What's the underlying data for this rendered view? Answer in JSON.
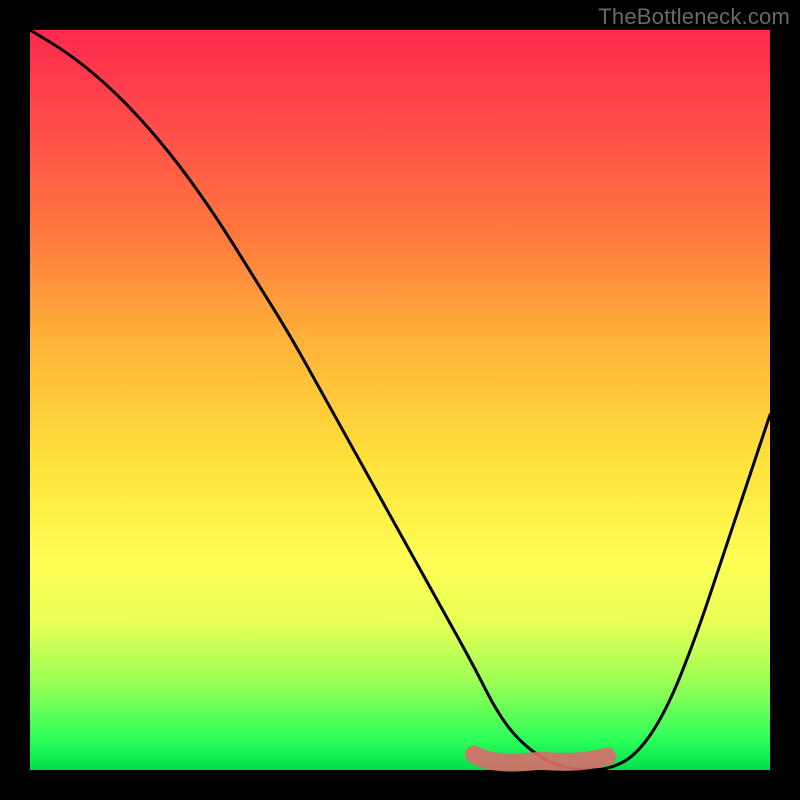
{
  "watermark": "TheBottleneck.com",
  "colors": {
    "curve": "#000000",
    "accent_blob": "#d66f6a",
    "background_black": "#000000"
  },
  "chart_data": {
    "type": "line",
    "title": "",
    "xlabel": "",
    "ylabel": "",
    "xlim": [
      0,
      100
    ],
    "ylim": [
      0,
      100
    ],
    "grid": false,
    "legend": false,
    "series": [
      {
        "name": "bottleneck-curve",
        "x": [
          0,
          5,
          10,
          15,
          20,
          25,
          30,
          35,
          40,
          45,
          50,
          55,
          60,
          63,
          66,
          70,
          74,
          78,
          82,
          86,
          90,
          94,
          98,
          100
        ],
        "y": [
          100,
          97,
          93,
          88,
          82,
          75,
          67,
          59,
          50,
          41,
          32,
          23,
          14,
          8,
          4,
          1,
          0,
          0,
          2,
          8,
          18,
          30,
          42,
          48
        ]
      }
    ],
    "annotations": [
      {
        "name": "accent-blob",
        "shape": "blob",
        "x_range": [
          60,
          78
        ],
        "y": 1
      }
    ],
    "gradient_stops": [
      {
        "pos": 0,
        "color": "#ff2a4d"
      },
      {
        "pos": 50,
        "color": "#ffe13a"
      },
      {
        "pos": 100,
        "color": "#00e04a"
      }
    ]
  }
}
